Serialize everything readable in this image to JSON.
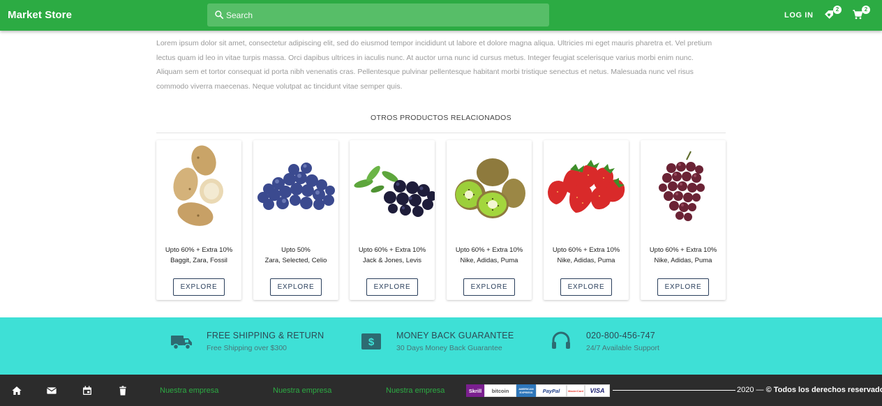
{
  "header": {
    "brand": "Market Store",
    "search_placeholder": "Search",
    "login_label": "LOG IN",
    "wishlist_count": "2",
    "cart_count": "2"
  },
  "description": "Lorem ipsum dolor sit amet, consectetur adipiscing elit, sed do eiusmod tempor incididunt ut labore et dolore magna aliqua. Ultricies mi eget mauris pharetra et. Vel pretium lectus quam id leo in vitae turpis massa. Orci dapibus ultrices in iaculis nunc. At auctor urna nunc id cursus metus. Integer feugiat scelerisque varius morbi enim nunc. Aliquam sem et tortor consequat id porta nibh venenatis cras. Pellentesque pulvinar pellentesque habitant morbi tristique senectus et netus. Malesuada nunc vel risus commodo viverra maecenas. Neque volutpat ac tincidunt vitae semper quis.",
  "related": {
    "title": "OTROS PRODUCTOS RELACIONADOS",
    "products": [
      {
        "image": "potatoes",
        "offer": "Upto 60% + Extra 10%",
        "brands": "Baggit, Zara, Fossil",
        "button": "EXPLORE"
      },
      {
        "image": "blueberries",
        "offer": "Upto 50%",
        "brands": "Zara, Selected, Celio",
        "button": "EXPLORE"
      },
      {
        "image": "blackcurrants",
        "offer": "Upto 60% + Extra 10%",
        "brands": "Jack & Jones, Levis",
        "button": "EXPLORE"
      },
      {
        "image": "kiwis",
        "offer": "Upto 60% + Extra 10%",
        "brands": "Nike, Adidas, Puma",
        "button": "EXPLORE"
      },
      {
        "image": "strawberries",
        "offer": "Upto 60% + Extra 10%",
        "brands": "Nike, Adidas, Puma",
        "button": "EXPLORE"
      },
      {
        "image": "grapes",
        "offer": "Upto 60% + Extra 10%",
        "brands": "Nike, Adidas, Puma",
        "button": "EXPLORE"
      }
    ]
  },
  "features": [
    {
      "icon": "truck-icon",
      "title": "FREE SHIPPING & RETURN",
      "subtitle": "Free Shipping over $300"
    },
    {
      "icon": "money-icon",
      "title": "MONEY BACK GUARANTEE",
      "subtitle": "30 Days Money Back Guarantee"
    },
    {
      "icon": "headset-icon",
      "title": "020-800-456-747",
      "subtitle": "24/7 Available Support"
    }
  ],
  "footer": {
    "icons": [
      "home-icon",
      "mail-icon",
      "calendar-icon",
      "trash-icon"
    ],
    "links": [
      "Nuestra empresa",
      "Nuestra empresa",
      "Nuestra empresa"
    ],
    "payments": [
      "Skrill",
      "bitcoin",
      "AMERICAN EXPRESS",
      "PayPal",
      "MasterCard",
      "VISA"
    ],
    "copyright_year": "2020 —",
    "copyright_text": "© Todos los derechos reservados"
  },
  "colors": {
    "primary_green": "#2cab43",
    "search_green": "#57be68",
    "feature_band": "#3ee0d6",
    "footer_bg": "#2c2c2c",
    "button_border": "#2a3f5c"
  }
}
